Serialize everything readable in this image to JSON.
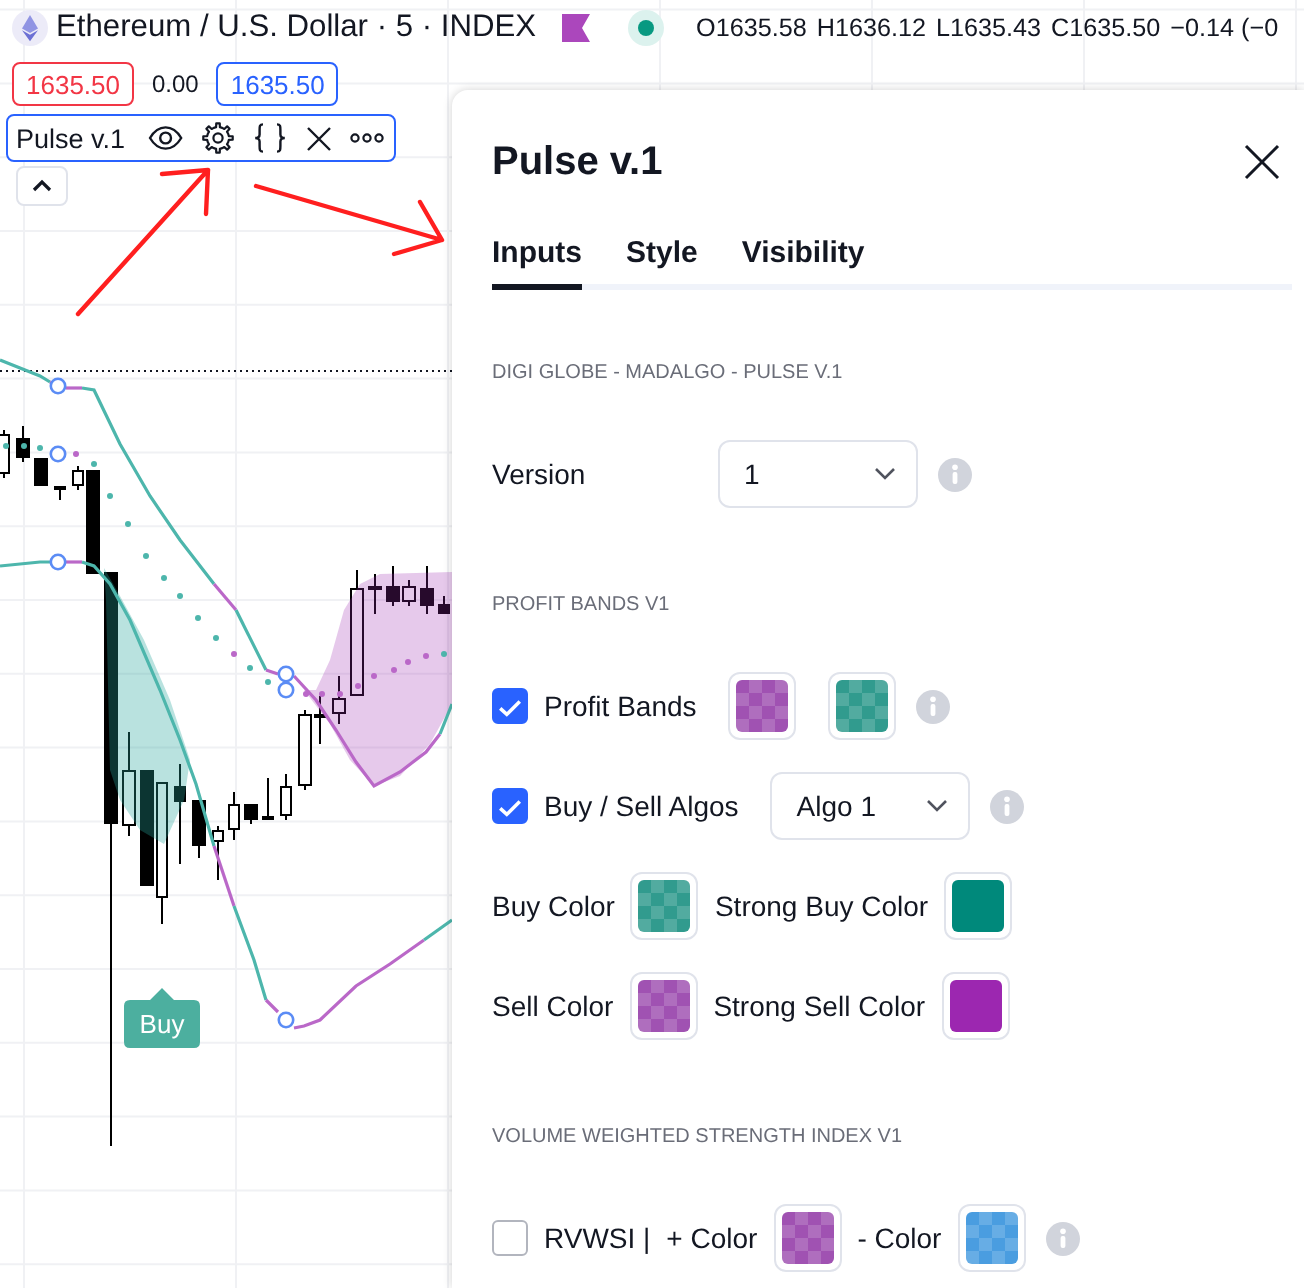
{
  "chart_header": {
    "title": "Ethereum / U.S. Dollar · 5 · INDEX",
    "values": [
      "O1635.58",
      "H1636.12",
      "L1635.43",
      "C1635.50",
      "−0.14 (−0"
    ]
  },
  "price_boxes": [
    {
      "kind": "sell",
      "text": "1635.50"
    },
    {
      "kind": "spread",
      "text": "0.00"
    },
    {
      "kind": "buy",
      "text": "1635.50"
    }
  ],
  "indicator_legend": {
    "name": "Pulse v.1",
    "selected": true
  },
  "chart": {
    "signal": {
      "kind": "buy",
      "text": "Buy"
    }
  },
  "dialog": {
    "title": "Pulse v.1",
    "tabs": [
      {
        "label": "Inputs",
        "selected": true
      },
      {
        "label": "Style",
        "selected": false
      },
      {
        "label": "Visibility",
        "selected": false
      }
    ],
    "sections": [
      {
        "title": "DIGI GLOBE - MADALGO - PULSE V.1",
        "rows": [
          {
            "kind": "labeled",
            "controls": [
              {
                "kind": "label",
                "text": "Version"
              },
              {
                "kind": "select",
                "value": "1"
              },
              {
                "kind": "info"
              }
            ]
          }
        ]
      },
      {
        "title": "PROFIT BANDS V1",
        "rows": [
          {
            "kind": "inline",
            "controls": [
              {
                "kind": "checkbox",
                "label": "Profit Bands",
                "checked": true
              },
              {
                "kind": "swatch",
                "color": "#a052b2",
                "checkered": true
              },
              {
                "kind": "swatch",
                "color": "#319b8e",
                "checkered": true
              },
              {
                "kind": "info"
              }
            ]
          },
          {
            "kind": "inline",
            "controls": [
              {
                "kind": "checkbox",
                "label": "Buy / Sell Algos",
                "checked": true
              },
              {
                "kind": "select",
                "value": "Algo 1"
              },
              {
                "kind": "info"
              }
            ]
          },
          {
            "kind": "inline",
            "controls": [
              {
                "kind": "label",
                "text": "Buy Color"
              },
              {
                "kind": "swatch",
                "color": "#319b8e",
                "checkered": true
              },
              {
                "kind": "label",
                "text": "Strong Buy Color"
              },
              {
                "kind": "swatch",
                "color": "#00897b",
                "checkered": false
              }
            ]
          },
          {
            "kind": "inline",
            "controls": [
              {
                "kind": "label",
                "text": "Sell Color"
              },
              {
                "kind": "swatch",
                "color": "#a052b2",
                "checkered": true
              },
              {
                "kind": "label",
                "text": "Strong Sell Color"
              },
              {
                "kind": "swatch",
                "color": "#9c27b0",
                "checkered": false
              }
            ]
          }
        ]
      },
      {
        "title": "VOLUME WEIGHTED STRENGTH INDEX V1",
        "rows": [
          {
            "kind": "inline",
            "controls": [
              {
                "kind": "checkbox",
                "label": "RVWSI |",
                "checked": false
              },
              {
                "kind": "label",
                "text": "+ Color"
              },
              {
                "kind": "swatch",
                "color": "#a052b2",
                "checkered": true
              },
              {
                "kind": "label",
                "text": "- Color"
              },
              {
                "kind": "swatch",
                "color": "#4a9de0",
                "checkered": true
              },
              {
                "kind": "info"
              }
            ]
          }
        ]
      }
    ]
  }
}
